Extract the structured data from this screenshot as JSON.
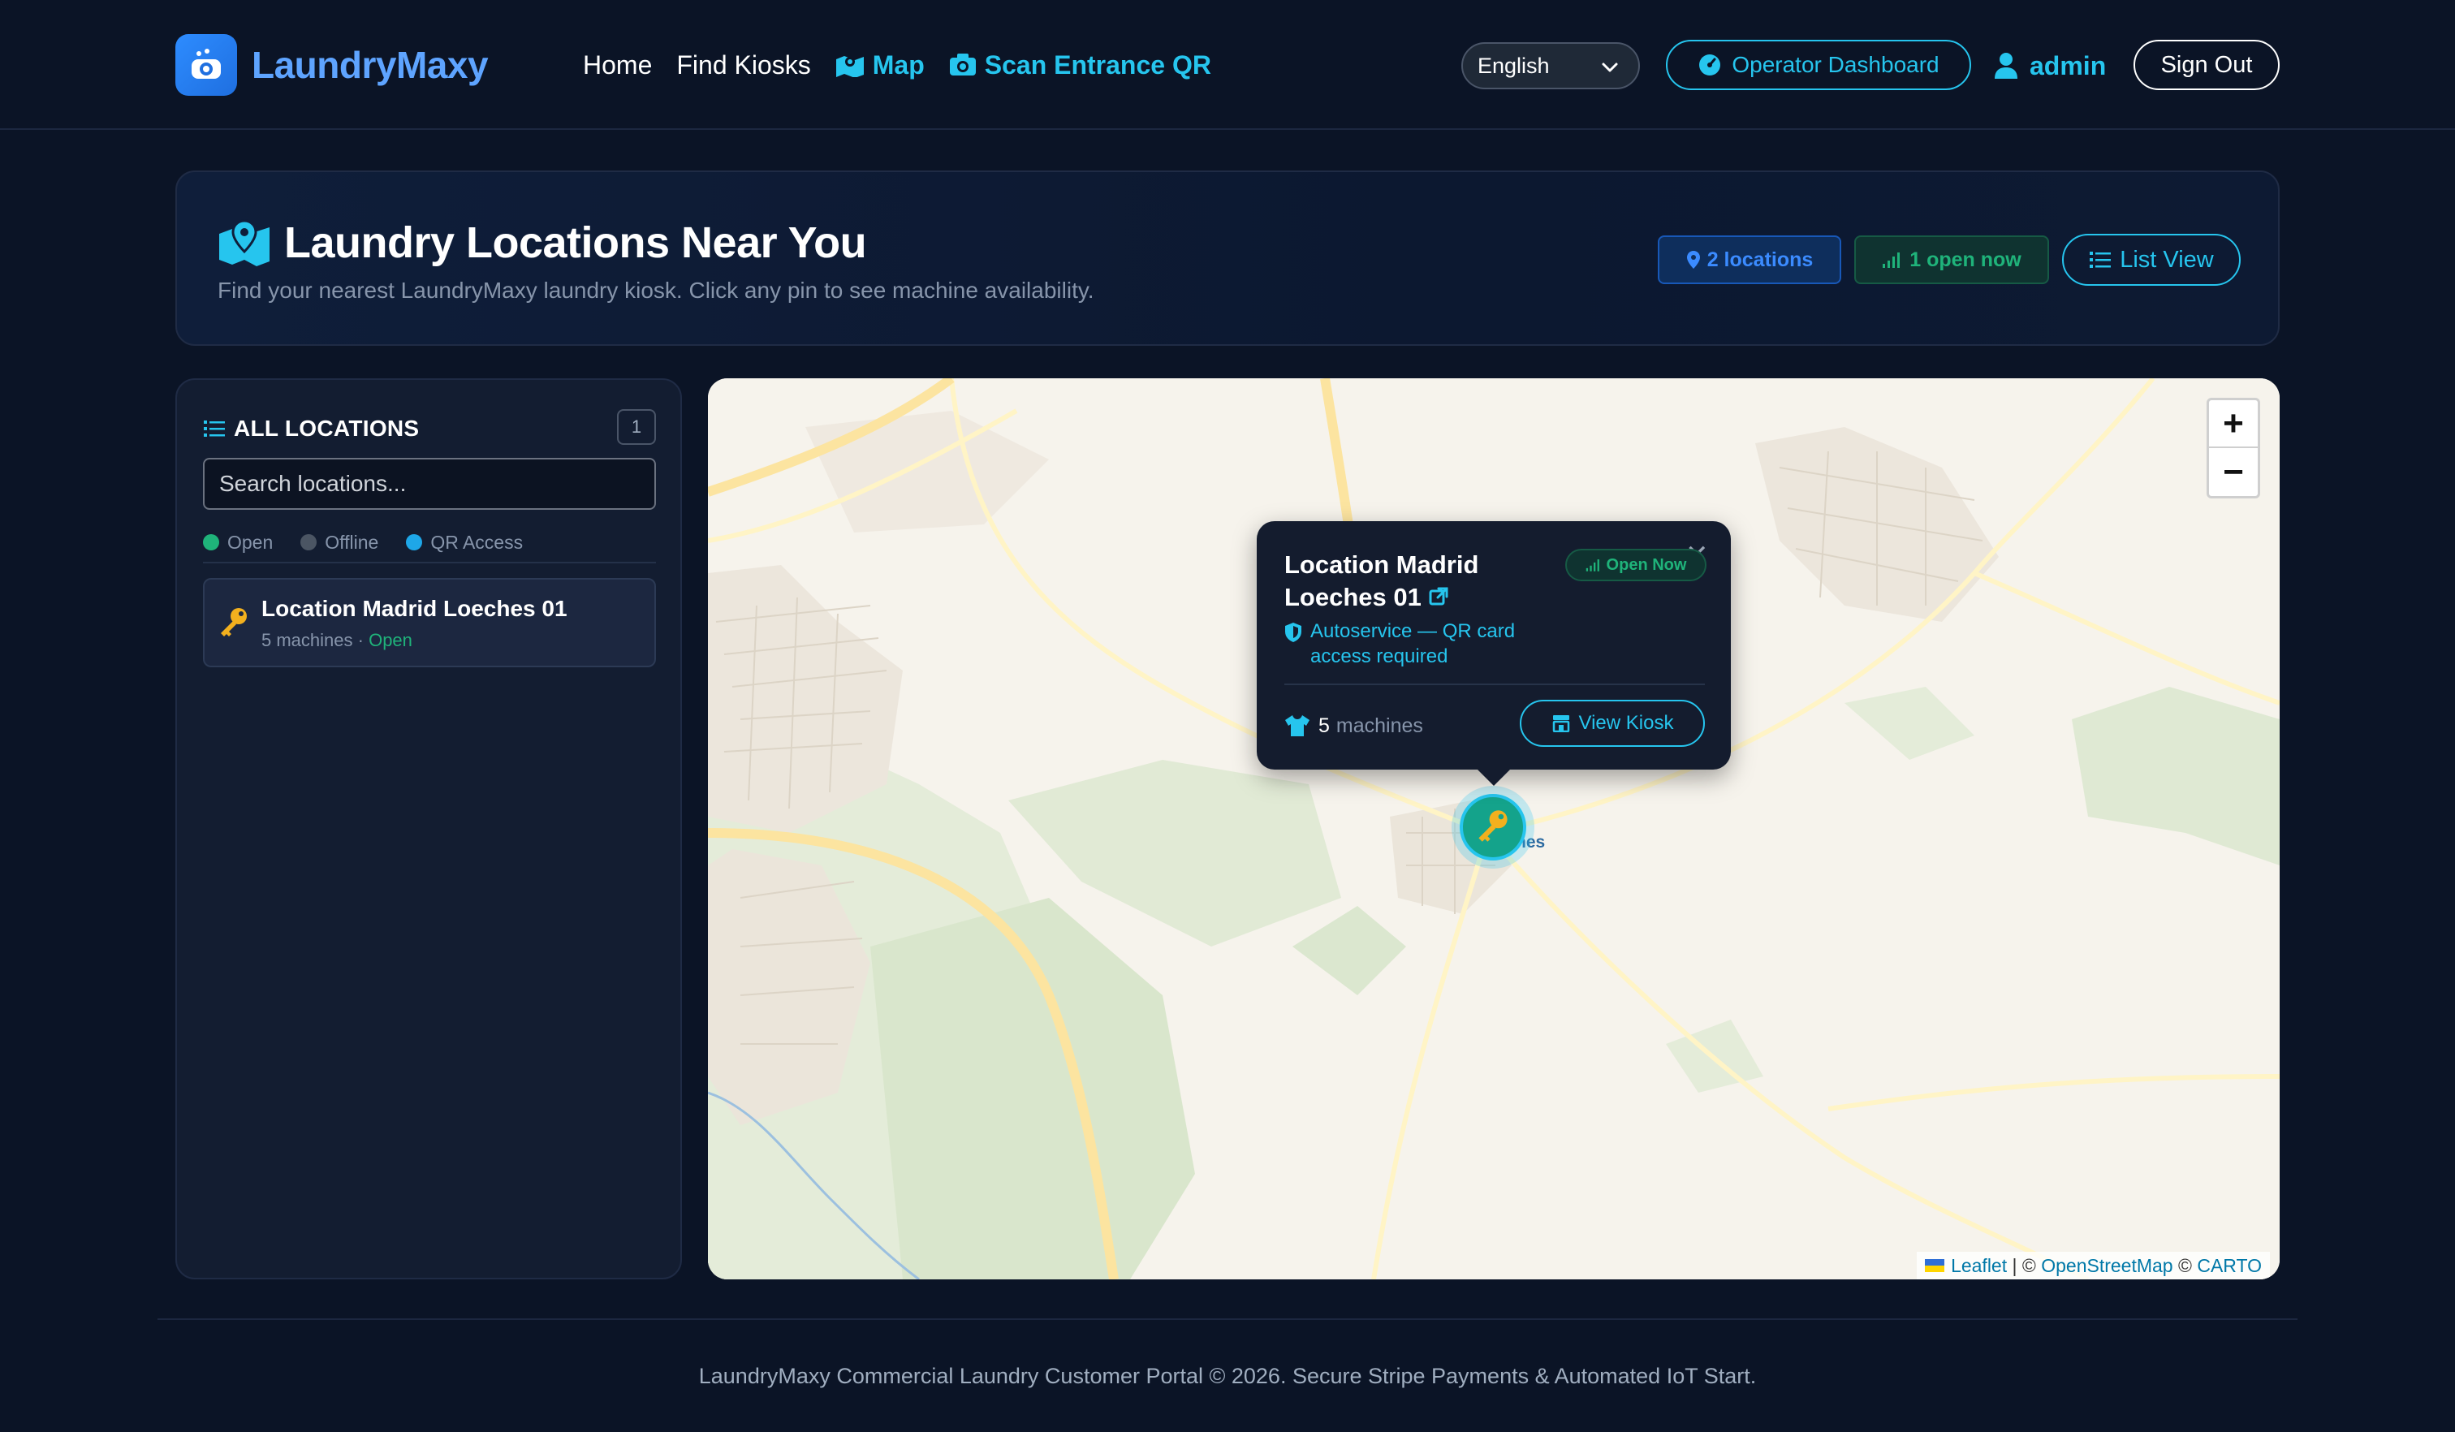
{
  "brand": {
    "name": "LaundryMaxy",
    "logo_icon": "washer-icon",
    "accent": "#2d8cff"
  },
  "nav": {
    "home": "Home",
    "find_kiosks": "Find Kiosks",
    "map": "Map",
    "scan_qr": "Scan Entrance QR"
  },
  "language": {
    "selected": "English"
  },
  "operator_dashboard": "Operator Dashboard",
  "user": {
    "name": "admin"
  },
  "sign_out": "Sign Out",
  "header": {
    "title": "Laundry Locations Near You",
    "subtitle": "Find your nearest LaundryMaxy laundry kiosk. Click any pin to see machine availability.",
    "locations_badge": "2 locations",
    "open_badge": "1 open now",
    "list_view": "List View"
  },
  "sidebar": {
    "title": "ALL LOCATIONS",
    "count": "1",
    "search_placeholder": "Search locations...",
    "legend": [
      {
        "label": "Open",
        "color": "#1fb37a"
      },
      {
        "label": "Offline",
        "color": "#4b5563"
      },
      {
        "label": "QR Access",
        "color": "#1ea7e8"
      }
    ],
    "items": [
      {
        "name": "Location Madrid Loeches 01",
        "machines": "5 machines",
        "separator": " · ",
        "status": "Open"
      }
    ]
  },
  "map": {
    "town_label": "Loeches",
    "zoom_in": "+",
    "zoom_out": "−",
    "attribution": {
      "leaflet": "Leaflet",
      "sep1": " | © ",
      "osm": "OpenStreetMap",
      "sep2": " © ",
      "carto": "CARTO"
    }
  },
  "popup": {
    "title": "Location Madrid Loeches 01",
    "status": "Open Now",
    "access": "Autoservice — QR card access required",
    "machines_count": "5",
    "machines_label": "machines",
    "view_kiosk": "View Kiosk",
    "close": "✕"
  },
  "footer": {
    "text": "LaundryMaxy Commercial Laundry Customer Portal © 2026. Secure Stripe Payments & Automated IoT Start."
  }
}
